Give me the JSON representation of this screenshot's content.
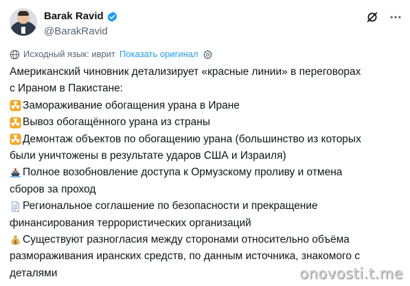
{
  "author": {
    "name": "Barak Ravid",
    "handle": "@BarakRavid"
  },
  "header_icons": [
    "grok-icon",
    "more-options-icon"
  ],
  "translation": {
    "source_label": "Исходный язык: иврит",
    "show_original": "Показать оригинал"
  },
  "tweet": {
    "lines": [
      {
        "emoji": "",
        "text": "Американский чиновник детализирует «красные линии» в переговорах"
      },
      {
        "emoji": "",
        "text": "с Ираном в Пакистане:"
      },
      {
        "emoji": "radioactive-icon",
        "text": "Замораживание обогащения урана в Иране"
      },
      {
        "emoji": "radioactive-icon",
        "text": "Вывоз обогащённого урана из страны"
      },
      {
        "emoji": "radioactive-icon",
        "text": "Демонтаж объектов по обогащению урана (большинство из которых"
      },
      {
        "emoji": "",
        "text": "были уничтожены в результате ударов США и Израиля)"
      },
      {
        "emoji": "ship-icon",
        "text": "Полное возобновление доступа к Ормузскому проливу и отмена"
      },
      {
        "emoji": "",
        "text": "сборов за проход"
      },
      {
        "emoji": "document-icon",
        "text": "Региональное соглашение по безопасности и прекращение"
      },
      {
        "emoji": "",
        "text": "финансирования террористических организаций"
      },
      {
        "emoji": "money-bag-icon",
        "text": "Существуют разногласия между сторонами относительно объёма"
      },
      {
        "emoji": "",
        "text": "размораживания иранских средств, по данным источника, знакомого с"
      },
      {
        "emoji": "",
        "text": "деталями"
      }
    ]
  },
  "watermark": "onovosti.t.me",
  "colors": {
    "text": "#0f1419",
    "secondary": "#536471",
    "link": "#1d9bf0",
    "verified": "#1d9bf0",
    "radioactive": "#f4a623"
  }
}
